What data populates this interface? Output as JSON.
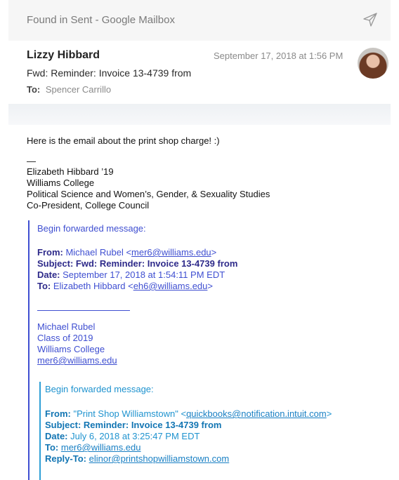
{
  "window": {
    "title": "Found in Sent - Google Mailbox"
  },
  "header": {
    "from_name": "Lizzy Hibbard",
    "date": "September 17, 2018 at 1:56 PM",
    "subject": "Fwd: Reminder: Invoice 13-4739 from",
    "to_label": "To:",
    "to_value": "Spencer Carrillo"
  },
  "body": {
    "intro": "Here is the email about the print shop charge! :)",
    "dash": "—",
    "signature": [
      "Elizabeth Hibbard ’19",
      "Williams College",
      "Political Science and Women’s, Gender, & Sexuality Studies",
      "Co-President, College Council"
    ]
  },
  "forward1": {
    "heading": "Begin forwarded message:",
    "from_label": "From:",
    "from_value": "Michael Rubel <",
    "from_email": "mer6@williams.edu",
    "from_close": ">",
    "subject_label": "Subject:",
    "subject_value": "Fwd: Reminder: Invoice 13-4739 from",
    "date_label": "Date:",
    "date_value": "September 17, 2018 at 1:54:11 PM EDT",
    "to_label": "To:",
    "to_value": "Elizabeth Hibbard <",
    "to_email": "eh6@williams.edu",
    "to_close": ">",
    "signature": [
      "Michael Rubel",
      "Class of 2019",
      "Williams College"
    ],
    "signature_email": "mer6@williams.edu"
  },
  "forward2": {
    "heading": "Begin forwarded message:",
    "from_label": "From:",
    "from_value": "\"Print Shop Williamstown\" <",
    "from_email": "quickbooks@notification.intuit.com",
    "from_close": ">",
    "subject_label": "Subject:",
    "subject_value": "Reminder: Invoice 13-4739 from",
    "date_label": "Date:",
    "date_value": "July 6, 2018 at 3:25:47 PM EDT",
    "to_label": "To:",
    "to_email": "mer6@williams.edu",
    "replyto_label": "Reply-To:",
    "replyto_email": "elinor@printshopwilliamstown.com"
  },
  "icons": {
    "send": "send-icon",
    "avatar": "avatar"
  },
  "colors": {
    "quote1": "#3f4fd1",
    "quote2": "#2e9fd6"
  }
}
